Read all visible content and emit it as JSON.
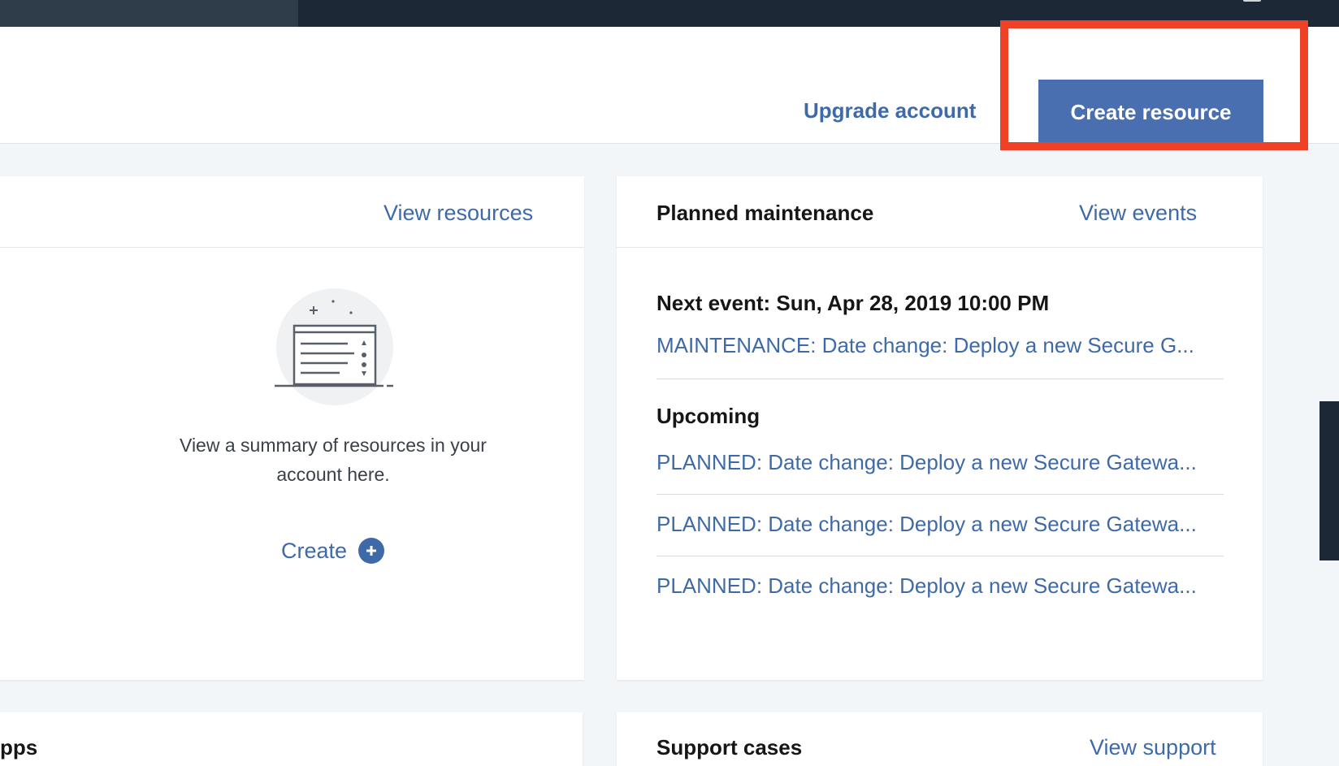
{
  "header": {
    "upgrade_label": "Upgrade account",
    "create_label": "Create resource"
  },
  "resources_card": {
    "view_link": "View resources",
    "summary": "View a summary of resources in your account here.",
    "create_label": "Create",
    "create_icon": "plus-circle-icon",
    "illustration_icon": "empty-resources-illustration"
  },
  "maintenance_card": {
    "title": "Planned maintenance",
    "view_link": "View events",
    "next_event_label": "Next event: Sun, Apr 28, 2019 10:00 PM",
    "next_event_item": "MAINTENANCE: Date change: Deploy a new Secure G...",
    "upcoming_label": "Upcoming",
    "upcoming_items": [
      "PLANNED: Date change: Deploy a new Secure Gatewa...",
      "PLANNED: Date change: Deploy a new Secure Gatewa...",
      "PLANNED: Date change: Deploy a new Secure Gatewa..."
    ]
  },
  "apps_card": {
    "title_fragment": "pps"
  },
  "support_card": {
    "title": "Support cases",
    "view_link": "View support"
  },
  "colors": {
    "accent": "#4a6fb0",
    "link": "#3f6aa8",
    "highlight": "#ee4125",
    "nav": "#1c2836"
  }
}
